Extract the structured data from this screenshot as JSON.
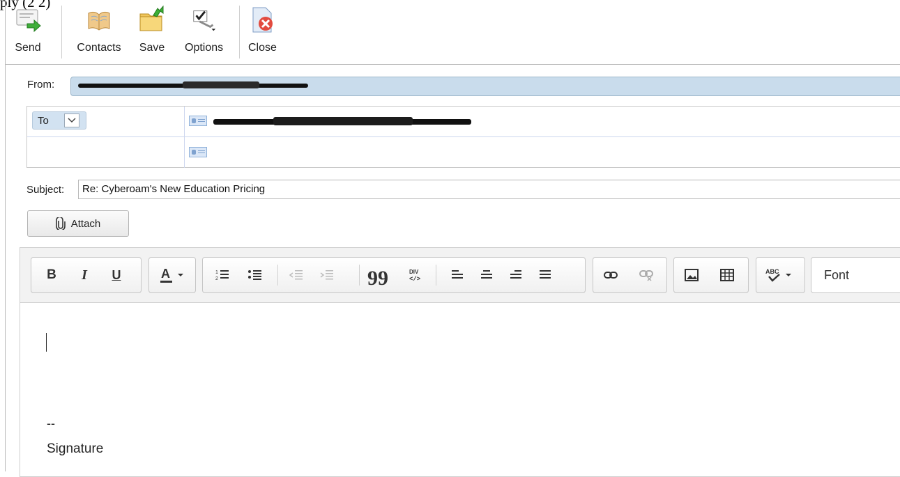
{
  "window": {
    "crop_caption": "ply (2 2)"
  },
  "toolbar": {
    "send": "Send",
    "contacts": "Contacts",
    "save": "Save",
    "options": "Options",
    "close": "Close"
  },
  "from": {
    "label": "From:"
  },
  "recipients": {
    "to_label": "To"
  },
  "subject": {
    "label": "Subject:",
    "value": "Re: Cyberoam's New Education Pricing"
  },
  "attach": {
    "label": "Attach"
  },
  "editor": {
    "font_label": "Font",
    "body": {
      "signature_separator": "--",
      "signature": "Signature"
    }
  },
  "colors": {
    "from_field": "#c9dcec",
    "to_select": "#d2e2f1",
    "toolbar_bg": "#f2f2f2"
  }
}
